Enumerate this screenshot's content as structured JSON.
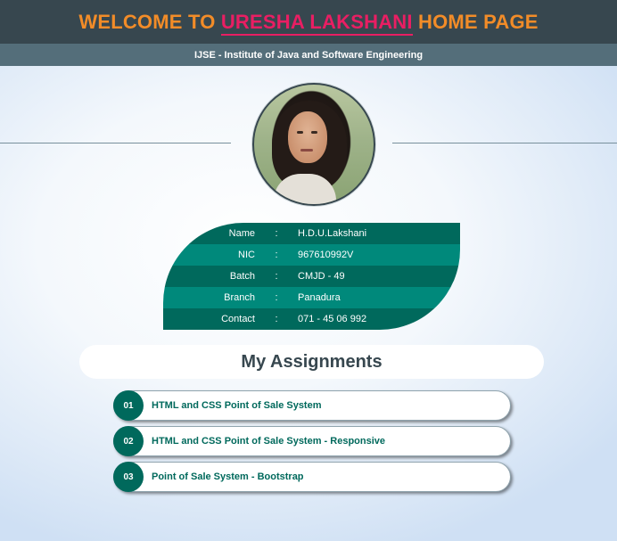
{
  "header": {
    "title_prefix": "WELCOME TO ",
    "title_name": "URESHA LAKSHANI",
    "title_suffix": " HOME PAGE",
    "subtitle": "IJSE - Institute of Java and Software Engineering"
  },
  "profile": {
    "rows": [
      {
        "label": "Name",
        "value": "H.D.U.Lakshani"
      },
      {
        "label": "NIC",
        "value": "967610992V"
      },
      {
        "label": "Batch",
        "value": "CMJD - 49"
      },
      {
        "label": "Branch",
        "value": "Panadura"
      },
      {
        "label": "Contact",
        "value": "071 - 45 06 992"
      }
    ],
    "separator": ":"
  },
  "assignments": {
    "heading": "My Assignments",
    "items": [
      {
        "num": "01",
        "title": "HTML and CSS Point of Sale System"
      },
      {
        "num": "02",
        "title": "HTML and CSS Point of Sale System - Responsive"
      },
      {
        "num": "03",
        "title": "Point of Sale System - Bootstrap"
      }
    ]
  },
  "colors": {
    "header_bg": "#37474f",
    "accent_orange": "#f28c28",
    "accent_pink": "#e91e63",
    "teal_dark": "#00695c",
    "teal_light": "#00897b"
  }
}
